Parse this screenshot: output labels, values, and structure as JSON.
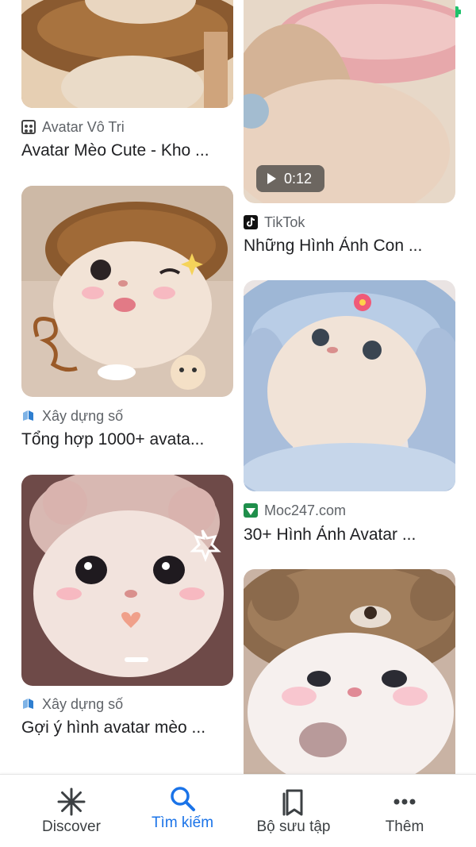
{
  "status_bar": {
    "battery_color": "#1ec26b"
  },
  "results": [
    {
      "source": "Avatar Vô Tri",
      "source_icon": "smiley-grid-icon",
      "title": "Avatar Mèo Cute - Kho ..."
    },
    {
      "source": "TikTok",
      "source_icon": "tiktok-icon",
      "title": "Những Hình Ảnh Con ...",
      "video_duration": "0:12"
    },
    {
      "source": "Xây dựng số",
      "source_icon": "book-icon",
      "title": "Tổng hợp 1000+ avata..."
    },
    {
      "source": "Moc247.com",
      "source_icon": "moc247-icon",
      "title": "30+ Hình Ảnh Avatar ..."
    },
    {
      "source": "Xây dựng số",
      "source_icon": "book-icon",
      "title": "Gợi ý hình avatar mèo ..."
    },
    {
      "source": "",
      "source_icon": "",
      "title": ""
    }
  ],
  "bottom_nav": {
    "items": [
      {
        "label": "Discover",
        "icon": "asterisk-icon"
      },
      {
        "label": "Tìm kiếm",
        "icon": "search-icon",
        "active": true
      },
      {
        "label": "Bộ sưu tập",
        "icon": "collections-icon"
      },
      {
        "label": "Thêm",
        "icon": "more-horiz-icon"
      }
    ],
    "active_color": "#1a73e8"
  }
}
